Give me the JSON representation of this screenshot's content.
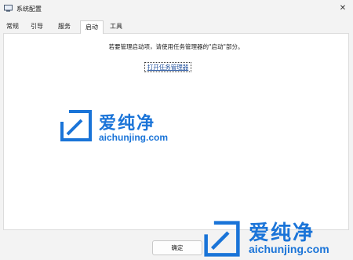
{
  "window": {
    "title": "系统配置",
    "app_icon": "system-config-icon",
    "close_icon": "close-icon",
    "close_glyph": "✕"
  },
  "tabs": [
    {
      "label": "常规"
    },
    {
      "label": "引导"
    },
    {
      "label": "服务"
    },
    {
      "label": "启动",
      "selected": true
    },
    {
      "label": "工具"
    }
  ],
  "startup": {
    "message": "若要管理启动项，请使用任务管理器的\"启动\"部分。",
    "link_label": "打开任务管理器"
  },
  "watermark": {
    "brand_cn": "爱纯净",
    "brand_url": "aichunjing.com",
    "icon": "aichunjing-logo-icon",
    "accent_color": "#1a74d8"
  },
  "footer": {
    "ok_label": "确定"
  }
}
